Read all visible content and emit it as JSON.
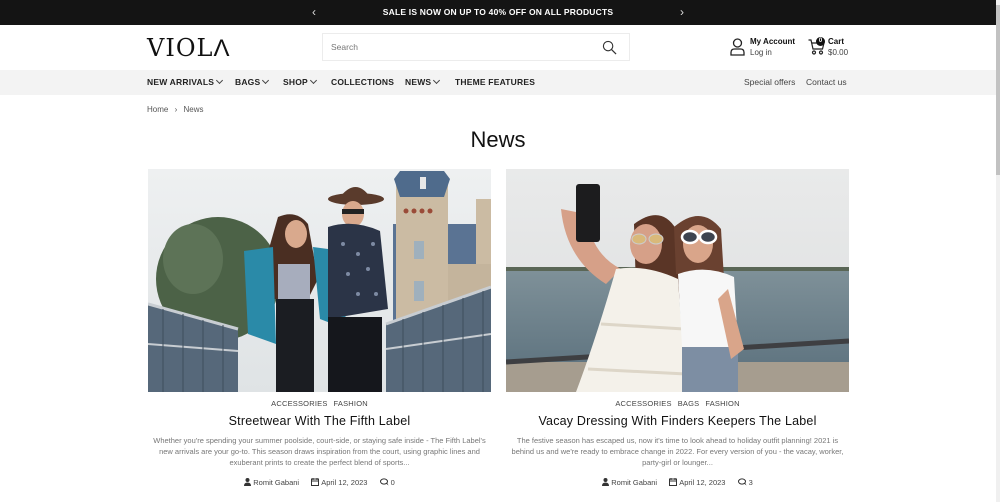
{
  "announcement": {
    "message": "SALE IS NOW ON UP TO 40% OFF ON ALL PRODUCTS",
    "prev_icon": "‹",
    "next_icon": "›"
  },
  "header": {
    "logo_text": "VIOL",
    "logo_last": "Λ",
    "search_placeholder": "Search",
    "account_title": "My Account",
    "account_sub": "Log in",
    "cart_title": "Cart",
    "cart_total": "$0.00",
    "cart_count": "0"
  },
  "nav": {
    "items": [
      {
        "label": "NEW ARRIVALS",
        "dropdown": true
      },
      {
        "label": "BAGS",
        "dropdown": true
      },
      {
        "label": "SHOP",
        "dropdown": true
      },
      {
        "label": "COLLECTIONS",
        "dropdown": false
      },
      {
        "label": "NEWS",
        "dropdown": true
      },
      {
        "label": "THEME FEATURES",
        "dropdown": false
      }
    ],
    "right_links": [
      "Special offers",
      "Contact us"
    ]
  },
  "breadcrumb": {
    "items": [
      "Home",
      "News"
    ],
    "separator": "›"
  },
  "page_title": "News",
  "articles": [
    {
      "tags": [
        "ACCESSORIES",
        "FASHION"
      ],
      "title": "Streetwear With The Fifth Label",
      "excerpt": "Whether you're spending your summer poolside, court-side, or staying safe inside - The Fifth Label's new arrivals are your go-to. This season draws inspiration from the court, using graphic lines and exuberant prints to create the perfect blend of sports...",
      "author": "Romit Gabani",
      "date": "April 12, 2023",
      "comments": "0",
      "image_alt": "Couple walking on a bridge, man in brown hat placing teal jacket on woman"
    },
    {
      "tags": [
        "ACCESSORIES",
        "BAGS",
        "FASHION"
      ],
      "title": "Vacay Dressing With Finders Keepers The Label",
      "excerpt": "The festive season has escaped us, now it's time to look ahead to holiday outfit planning! 2021 is behind us and we're ready to embrace change in 2022. For every version of you - the vacay, worker, party-girl or lounger...",
      "author": "Romit Gabani",
      "date": "April 12, 2023",
      "comments": "3",
      "image_alt": "Two women in sunglasses taking a selfie by the water"
    }
  ],
  "colors": {
    "announcement_bg": "#141414",
    "nav_bg": "#f3f3f3",
    "text_dark": "#111111",
    "text_muted": "#777777"
  }
}
